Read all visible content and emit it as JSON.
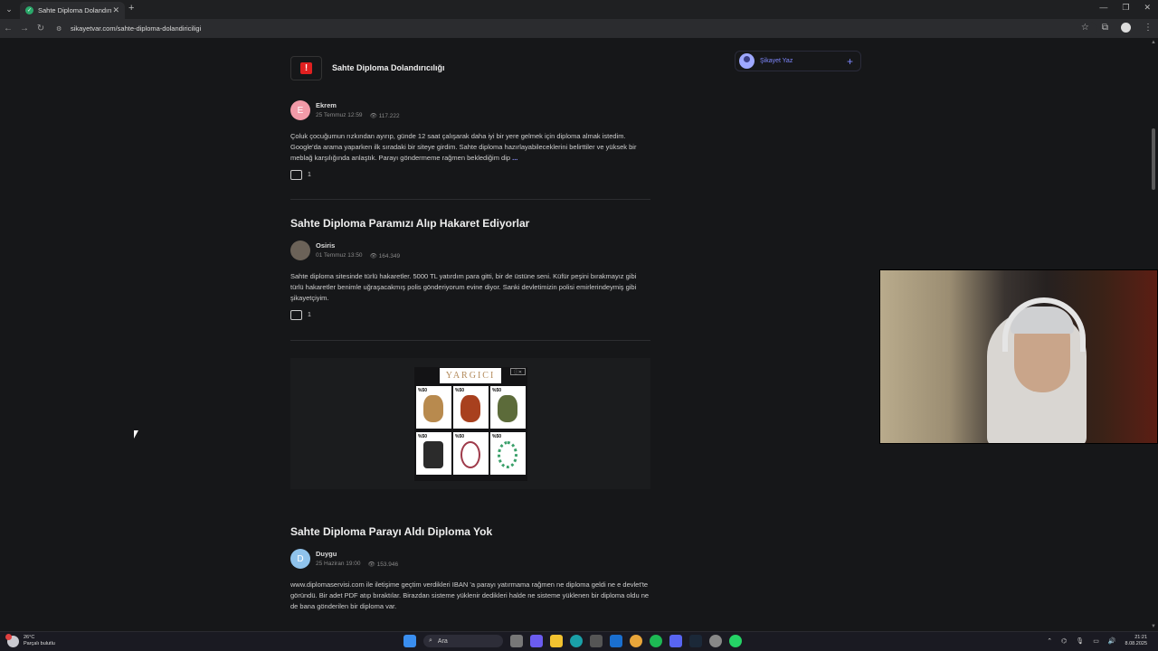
{
  "browser": {
    "tab_title": "Sahte Diploma Dolandırıcılığı",
    "tab_close": "✕",
    "new_tab": "+",
    "url": "sikayetvar.com/sahte-diploma-dolandiriciligi",
    "window_controls": [
      "—",
      "❐",
      "✕"
    ]
  },
  "category": {
    "title": "Sahte Diploma Dolandırıcılığı",
    "icon": "!"
  },
  "sidebar": {
    "write_complaint": "Şikayet Yaz",
    "plus": "+"
  },
  "posts": [
    {
      "title": "",
      "author": "Ekrem",
      "avatar_letter": "E",
      "avatar_color": "#f29aa8",
      "date": "25 Temmuz 12:59",
      "views": "117.222",
      "text": "Çoluk çocuğumun rızkından ayırıp, günde 12 saat çalışarak daha iyi bir yere gelmek için diploma almak istedim. Google'da arama yaparken ilk sıradaki bir siteye girdim. Sahte diploma hazırlayabileceklerini belirttiler ve yüksek bir meblağ karşılığında anlaştık. Parayı göndermeme rağmen beklediğim dip",
      "more": "...",
      "likes": "1"
    },
    {
      "title": "Sahte Diploma Paramızı Alıp Hakaret Ediyorlar",
      "author": "Osiris",
      "avatar_letter": "",
      "avatar_color": "#6b6258",
      "date": "01 Temmuz 13:50",
      "views": "164.349",
      "text": "Sahte diploma sitesinde türlü hakaretler. 5000 TL yatırdım para gitti, bir de üstüne seni. Küfür peşini bırakmayız gibi türlü hakaretler benimle uğraşacakmış polis gönderiyorum evine diyor. Sanki devletimizin polisi emirlerindeymiş gibi şikayetçiyim.",
      "more": "",
      "likes": "1"
    },
    {
      "title": "Sahte Diploma Parayı Aldı Diploma Yok",
      "author": "Duygu",
      "avatar_letter": "D",
      "avatar_color": "#8fc3ec",
      "date": "25 Haziran 19:00",
      "views": "153.946",
      "text": "www.diplomaservisi.com ile iletişime geçtim verdikleri IBAN 'a parayı yatırmama rağmen ne diploma geldi ne e devlet'te göründü. Bir adet PDF atıp bıraktılar. Birazdan sisteme yüklenir dedikleri halde ne sisteme yüklenen bir diploma oldu ne de bana gönderilen bir diploma var.",
      "more": "",
      "likes": ""
    }
  ],
  "ad": {
    "brand": "YARGICI",
    "close": "ⓘ✕",
    "discount": "%50"
  },
  "taskbar": {
    "temp": "26°C",
    "weather": "Parçalı bulutlu",
    "search": "Ara",
    "time": "21:21",
    "date": "8.08.2025"
  },
  "colors": {
    "accent": "#7f88ff",
    "category_red": "#e02020"
  }
}
